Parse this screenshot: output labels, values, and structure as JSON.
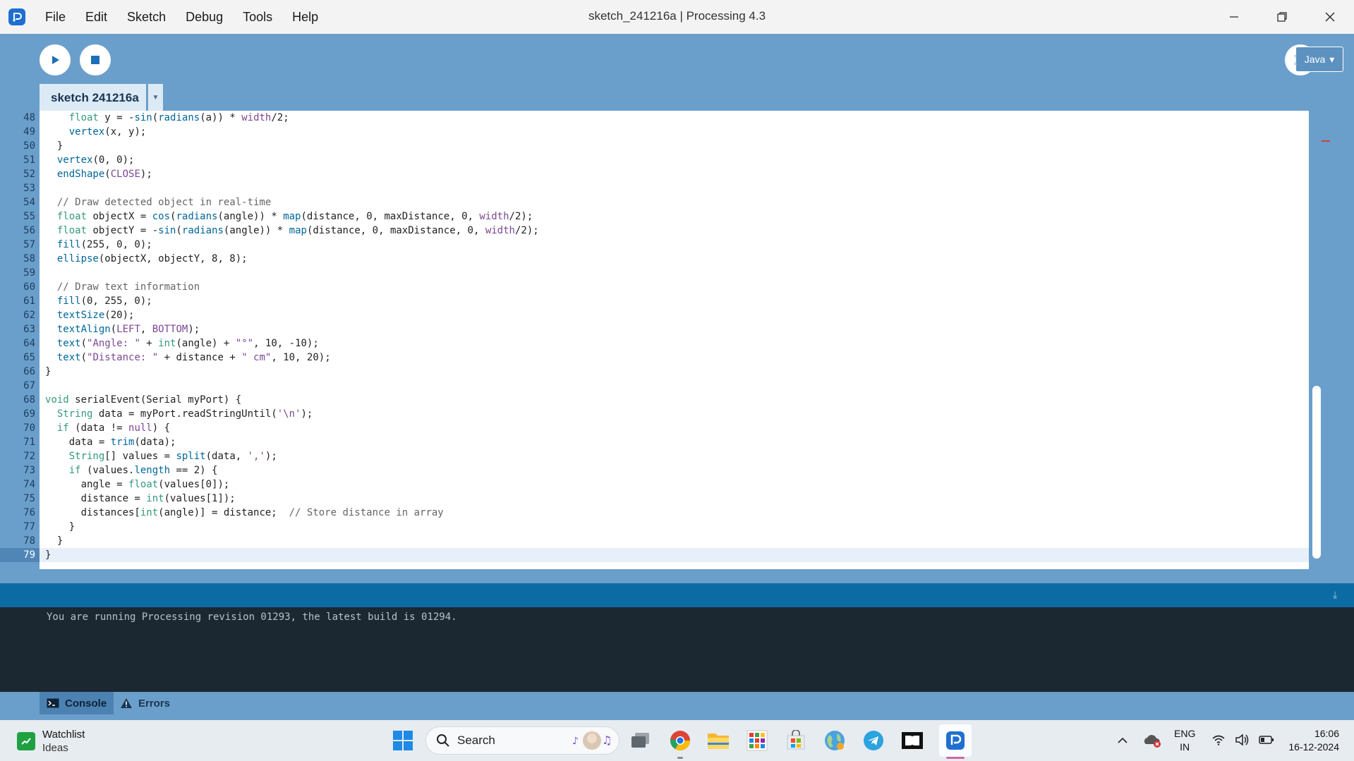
{
  "window": {
    "title": "sketch_241216a | Processing 4.3"
  },
  "menu": [
    "File",
    "Edit",
    "Sketch",
    "Debug",
    "Tools",
    "Help"
  ],
  "toolbar": {
    "mode_label": "Java",
    "tab_label": "sketch 241216a",
    "tab_menu_glyph": "▼"
  },
  "editor": {
    "current_line": 79,
    "lines": [
      {
        "num": "48",
        "text": "    float y = -sin(radians(a)) * width/2;"
      },
      {
        "num": "49",
        "text": "    vertex(x, y);"
      },
      {
        "num": "50",
        "text": "  }"
      },
      {
        "num": "51",
        "text": "  vertex(0, 0);"
      },
      {
        "num": "52",
        "text": "  endShape(CLOSE);"
      },
      {
        "num": "53",
        "text": ""
      },
      {
        "num": "54",
        "text": "  // Draw detected object in real-time"
      },
      {
        "num": "55",
        "text": "  float objectX = cos(radians(angle)) * map(distance, 0, maxDistance, 0, width/2);"
      },
      {
        "num": "56",
        "text": "  float objectY = -sin(radians(angle)) * map(distance, 0, maxDistance, 0, width/2);"
      },
      {
        "num": "57",
        "text": "  fill(255, 0, 0);"
      },
      {
        "num": "58",
        "text": "  ellipse(objectX, objectY, 8, 8);"
      },
      {
        "num": "59",
        "text": ""
      },
      {
        "num": "60",
        "text": "  // Draw text information"
      },
      {
        "num": "61",
        "text": "  fill(0, 255, 0);"
      },
      {
        "num": "62",
        "text": "  textSize(20);"
      },
      {
        "num": "63",
        "text": "  textAlign(LEFT, BOTTOM);"
      },
      {
        "num": "64",
        "text": "  text(\"Angle: \" + int(angle) + \"°\", 10, -10);"
      },
      {
        "num": "65",
        "text": "  text(\"Distance: \" + distance + \" cm\", 10, 20);"
      },
      {
        "num": "66",
        "text": "}"
      },
      {
        "num": "67",
        "text": ""
      },
      {
        "num": "68",
        "text": "void serialEvent(Serial myPort) {"
      },
      {
        "num": "69",
        "text": "  String data = myPort.readStringUntil('\\n');"
      },
      {
        "num": "70",
        "text": "  if (data != null) {"
      },
      {
        "num": "71",
        "text": "    data = trim(data);"
      },
      {
        "num": "72",
        "text": "    String[] values = split(data, ',');"
      },
      {
        "num": "73",
        "text": "    if (values.length == 2) {"
      },
      {
        "num": "74",
        "text": "      angle = float(values[0]);"
      },
      {
        "num": "75",
        "text": "      distance = int(values[1]);"
      },
      {
        "num": "76",
        "text": "      distances[int(angle)] = distance;  // Store distance in array"
      },
      {
        "num": "77",
        "text": "    }"
      },
      {
        "num": "78",
        "text": "  }"
      },
      {
        "num": "79",
        "text": "}"
      }
    ]
  },
  "console": {
    "message": "You are running Processing revision 01293, the latest build is 01294.",
    "tabs": {
      "console": "Console",
      "errors": "Errors"
    }
  },
  "taskbar": {
    "weather_title": "Watchlist",
    "weather_sub": "Ideas",
    "search_label": "Search",
    "lang_top": "ENG",
    "lang_bottom": "IN",
    "time": "16:06",
    "date": "16-12-2024"
  },
  "colors": {
    "toolbar_bg": "#6b9fcb",
    "console_bg": "#1b2731",
    "console_header": "#0c6ba3",
    "keyword": "#33997e",
    "function": "#006699",
    "string": "#7d4793",
    "comment": "#666666"
  }
}
